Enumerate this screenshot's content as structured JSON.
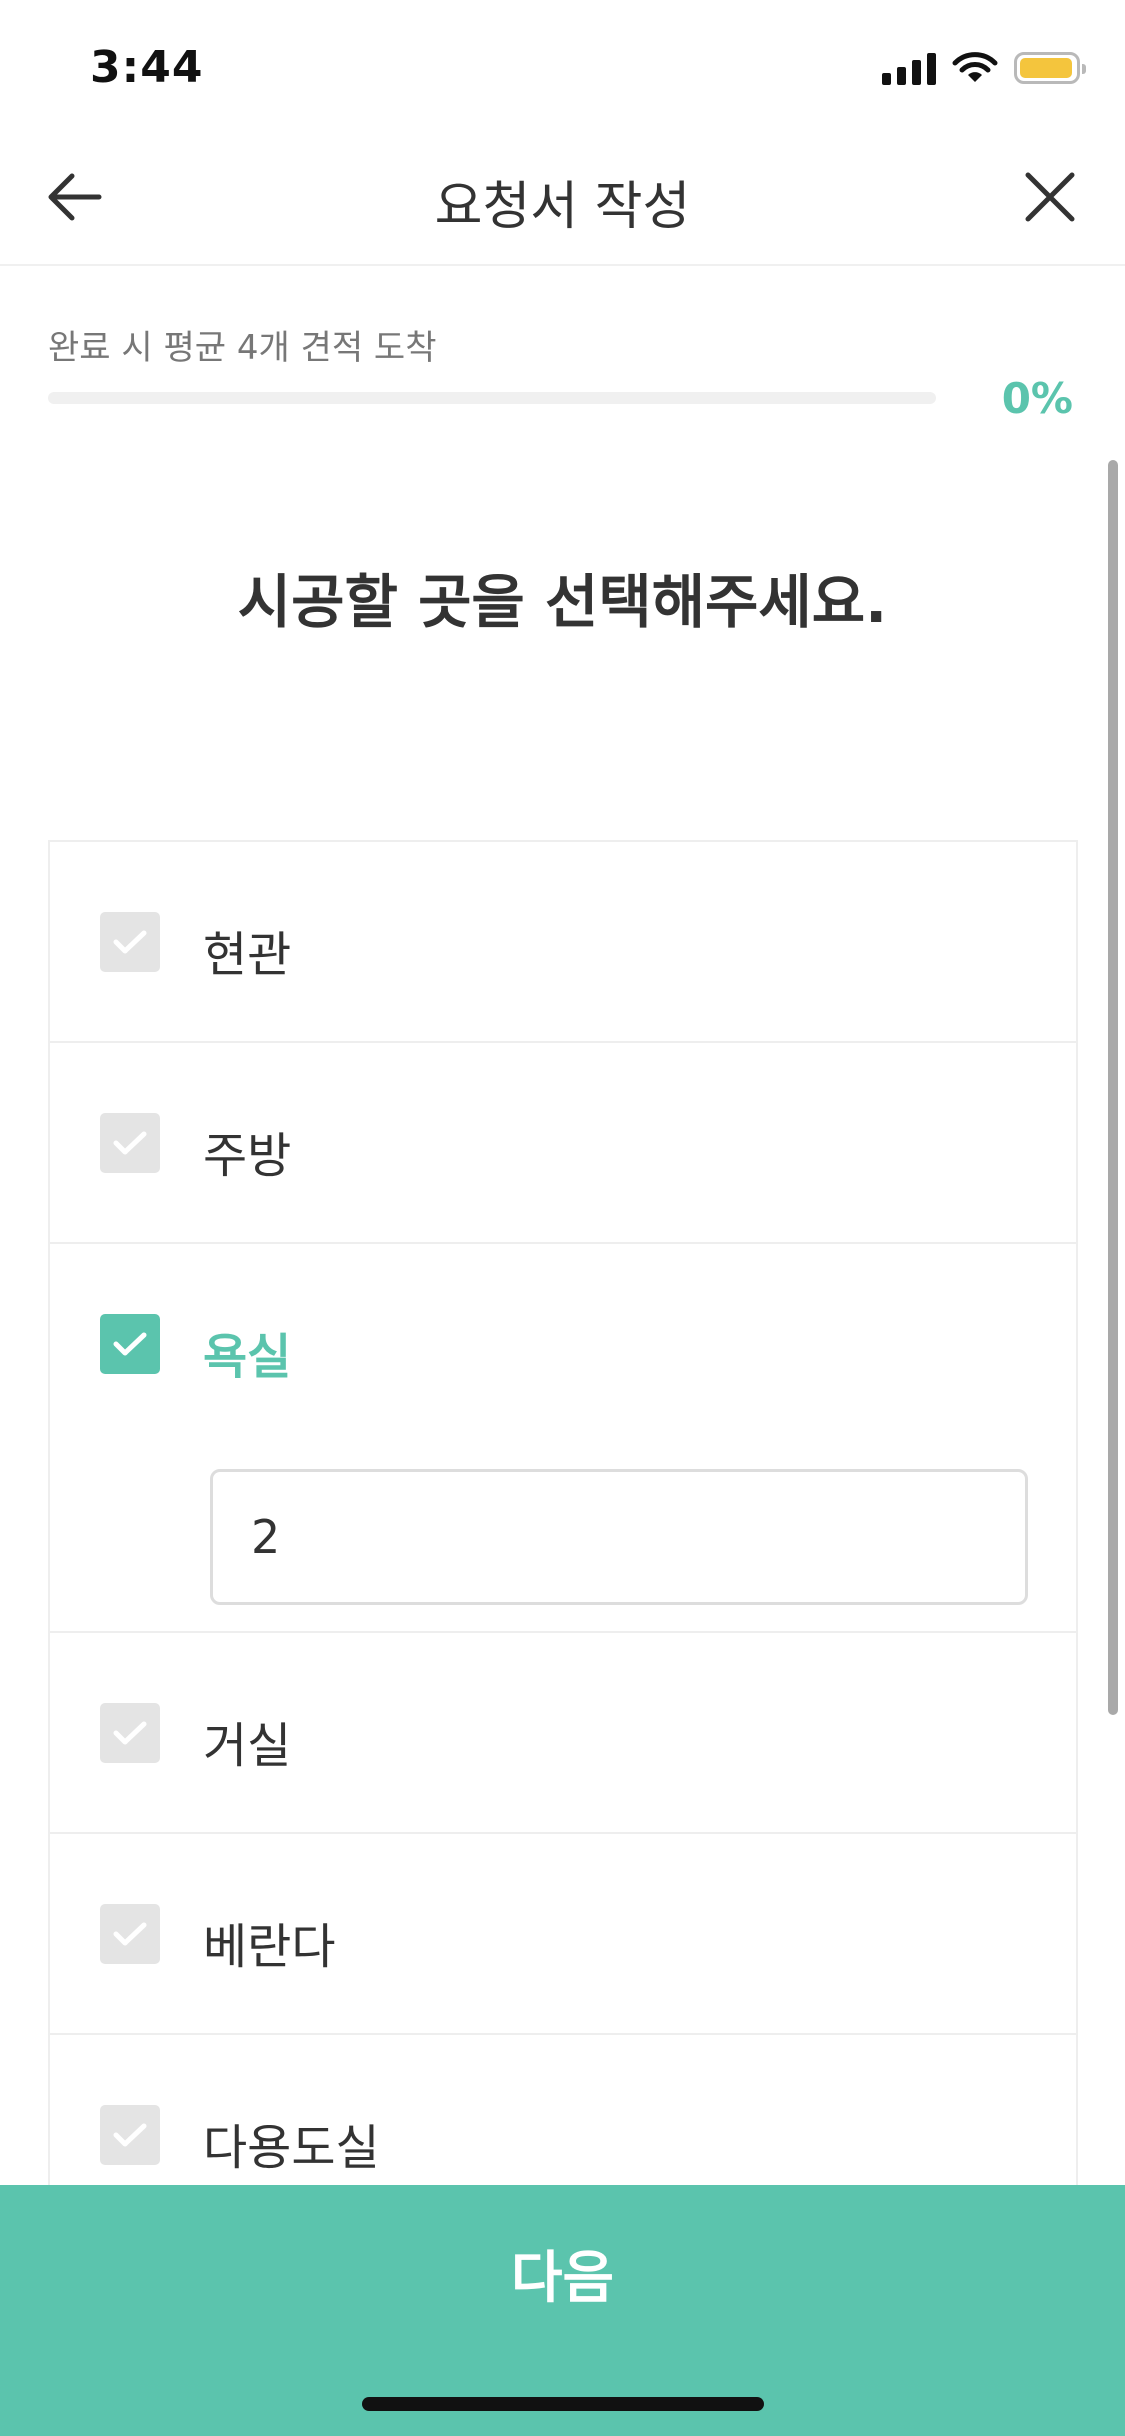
{
  "status_bar": {
    "time": "3:44"
  },
  "nav": {
    "title": "요청서 작성",
    "back_icon": "arrow-left-icon",
    "close_icon": "close-icon"
  },
  "progress": {
    "caption": "완료 시 평균 4개 견적 도착",
    "value": 0,
    "percent_label": "0%"
  },
  "question": {
    "title": "시공할 곳을 선택해주세요."
  },
  "options": [
    {
      "label": "현관",
      "checked": false
    },
    {
      "label": "주방",
      "checked": false
    },
    {
      "label": "욕실",
      "checked": true,
      "count": "2"
    },
    {
      "label": "거실",
      "checked": false
    },
    {
      "label": "베란다",
      "checked": false
    },
    {
      "label": "다용도실",
      "checked": false
    }
  ],
  "footer": {
    "next_label": "다음"
  },
  "colors": {
    "accent": "#5bc4ad",
    "checkbox_unchecked": "#e4e4e4",
    "battery": "#f4c53d"
  }
}
